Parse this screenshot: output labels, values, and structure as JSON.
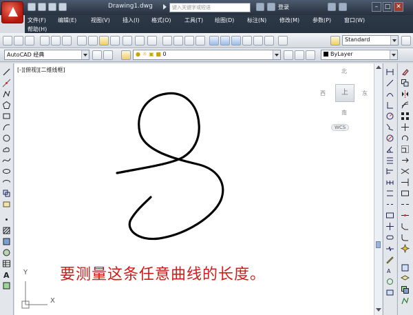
{
  "window": {
    "document_title": "Drawing1.dwg",
    "search_placeholder": "键入关键字或短语",
    "login_label": "登录",
    "minimize_label": "–",
    "maximize_label": "□",
    "close_label": "✕"
  },
  "menu": {
    "items": [
      "文件(F)",
      "编辑(E)",
      "视图(V)",
      "插入(I)",
      "格式(O)",
      "工具(T)",
      "绘图(D)",
      "标注(N)",
      "修改(M)",
      "参数(P)",
      "窗口(W)",
      "帮助(H)"
    ]
  },
  "toolbar": {
    "text_style_value": "Standard",
    "workspace_value": "AutoCAD 经典",
    "layer_value": "0",
    "color_value": "ByLayer"
  },
  "drawing": {
    "viewport_label": "[-][俯视][二维线框]",
    "viewcube": {
      "north": "北",
      "south": "南",
      "west": "西",
      "east": "东",
      "face": "上",
      "wcs": "WCS"
    },
    "caption": "要测量这条任意曲线的长度。",
    "ucs_y": "Y",
    "ucs_x": "X",
    "curve_color": "#000000",
    "caption_color": "#d21a18"
  }
}
